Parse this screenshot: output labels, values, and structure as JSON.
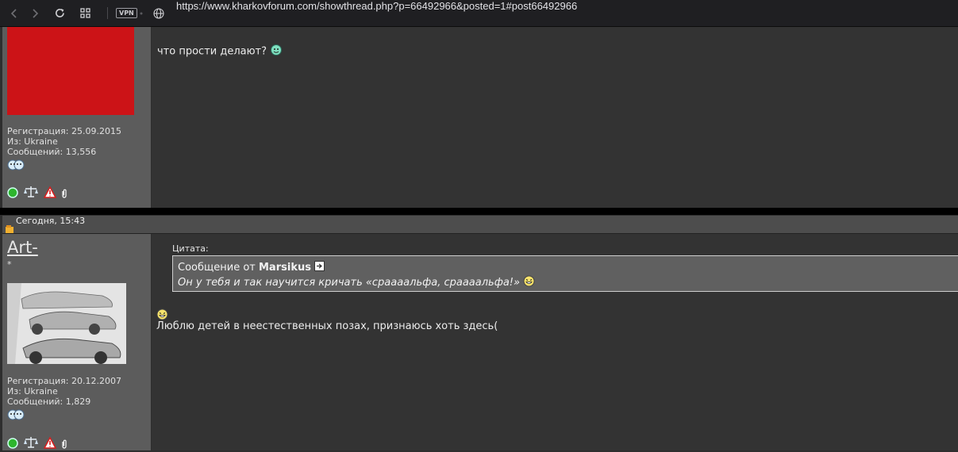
{
  "browser": {
    "url": "https://www.kharkovforum.com/showthread.php?p=66492966&posted=1#post66492966",
    "vpn_label": "VPN"
  },
  "post1": {
    "avatar_color": "#cc1317",
    "reg": "Регистрация: 25.09.2015",
    "from": "Из: Ukraine",
    "msgs": "Сообщений: 13,556",
    "message": "что прости делают?"
  },
  "post2": {
    "date": "Сегодня, 15:43",
    "username": "Art-",
    "rank_star": "*",
    "reg": "Регистрация: 20.12.2007",
    "from": "Из: Ukraine",
    "msgs": "Сообщений: 1,829",
    "quote_label": "Цитата:",
    "quote_prefix": "Сообщение от",
    "quote_author": "Marsikus",
    "quote_text": "Он у тебя и так научится кричать «сраааальфа, сраааальфа!»",
    "message": "Люблю детей в неестественных позах, признаюсь хоть здесь("
  }
}
